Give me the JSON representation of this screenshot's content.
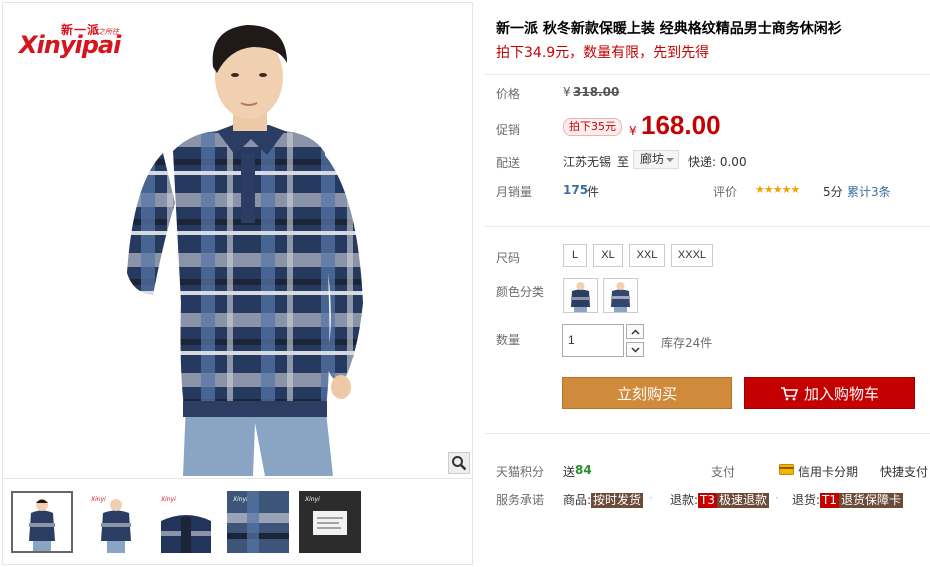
{
  "brand": {
    "cn": "新一派",
    "en": "Xinyipai",
    "slogan": "心之所往"
  },
  "product": {
    "title": "新一派 秋冬新款保暖上装 经典格纹精品男士商务休闲衫",
    "subtitle": "拍下34.9元，数量有限，先到先得"
  },
  "price": {
    "label": "价格",
    "currency": "¥",
    "original": "318.00"
  },
  "promo": {
    "label": "促销",
    "tag": "拍下35元",
    "currency": "¥",
    "price": "168.00"
  },
  "shipping": {
    "label": "配送",
    "from": "江苏无锡",
    "to_word": "至",
    "dest": "廊坊",
    "fee": "快递: 0.00"
  },
  "sales": {
    "label": "月销量",
    "count": "175",
    "unit": "件",
    "rating_label": "评价",
    "stars": "★★★★★",
    "score": "5分",
    "reviews": "累计3条"
  },
  "sizes": {
    "label": "尺码",
    "options": [
      "L",
      "XL",
      "XXL",
      "XXXL"
    ]
  },
  "colors": {
    "label": "颜色分类"
  },
  "quantity": {
    "label": "数量",
    "value": "1",
    "stock": "库存24件"
  },
  "buttons": {
    "buy": "立刻购买",
    "cart": "加入购物车"
  },
  "points": {
    "label": "天猫积分",
    "prefix": "送",
    "value": "84",
    "pay_label": "支付",
    "credit": "信用卡分期",
    "quick": "快捷支付"
  },
  "service": {
    "label": "服务承诺",
    "goods_label": "商品:",
    "goods_tag": "按时发货",
    "refund_label": "退款:",
    "refund_code": "T3",
    "refund_tag": "极速退款",
    "return_label": "退货:",
    "return_code": "T1",
    "return_tag": "退货保障卡"
  },
  "colors_theme": {
    "accent_red": "#c40000",
    "buy_orange": "#d08a3b",
    "sweater_navy": "#2b3d63"
  }
}
